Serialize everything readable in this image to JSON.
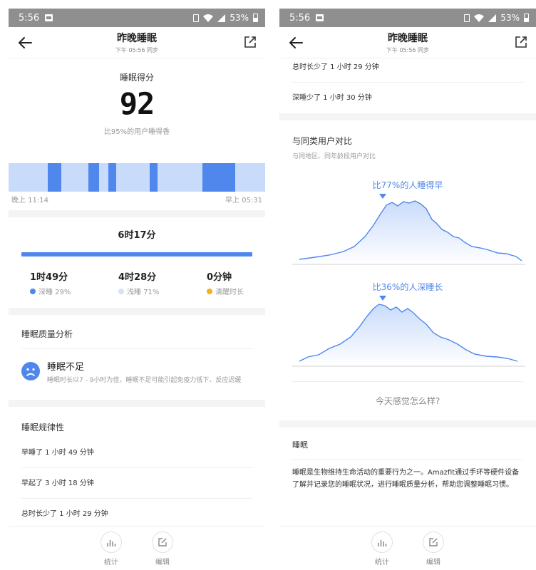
{
  "status_bar": {
    "time": "5:56",
    "battery": "53%"
  },
  "header": {
    "title": "昨晚睡眠",
    "sync_time": "下午 05:56 同步"
  },
  "score": {
    "label": "睡眠得分",
    "value": "92",
    "comparison": "比95%的用户睡得香"
  },
  "timeline": {
    "start_label": "晚上 11:14",
    "end_label": "早上 05:31"
  },
  "duration": {
    "total": "6时17分",
    "deep": {
      "value": "1时49分",
      "label": "深睡 29%",
      "color": "#4f87ec"
    },
    "light": {
      "value": "4时28分",
      "label": "浅睡 71%",
      "color": "#d5e2fa"
    },
    "awake": {
      "value": "0分钟",
      "label": "清醒时长",
      "color": "#f3b21b"
    }
  },
  "quality": {
    "section_title": "睡眠质量分析",
    "title": "睡眠不足",
    "description": "睡眠时长以7 - 9小时为佳，睡眠不足可能引起免疫力低下、反应迟缓"
  },
  "regularity": {
    "section_title": "睡眠规律性",
    "items": [
      "早睡了 1 小时 49 分钟",
      "早起了 3 小时 18 分钟",
      "总时长少了 1 小时 29 分钟",
      "深睡少了 1 小时 30 分钟"
    ]
  },
  "comparison": {
    "title": "与同类用户对比",
    "subtitle": "与同地区、同年龄段用户对比",
    "early_label": "比77%的人睡得早",
    "deep_label": "比36%的人深睡长"
  },
  "feel_prompt": "今天感觉怎么样?",
  "about": {
    "title": "睡眠",
    "text": "睡眠是生物维持生命活动的重要行为之一。Amazfit通过手环等硬件设备了解并记录您的睡眠状况，进行睡眠质量分析，帮助您调整睡眠习惯。"
  },
  "bottom_nav": {
    "stats_label": "统计",
    "edit_label": "编辑"
  },
  "colors": {
    "accent": "#4f87ec",
    "light_blue": "#c9dbfb"
  }
}
